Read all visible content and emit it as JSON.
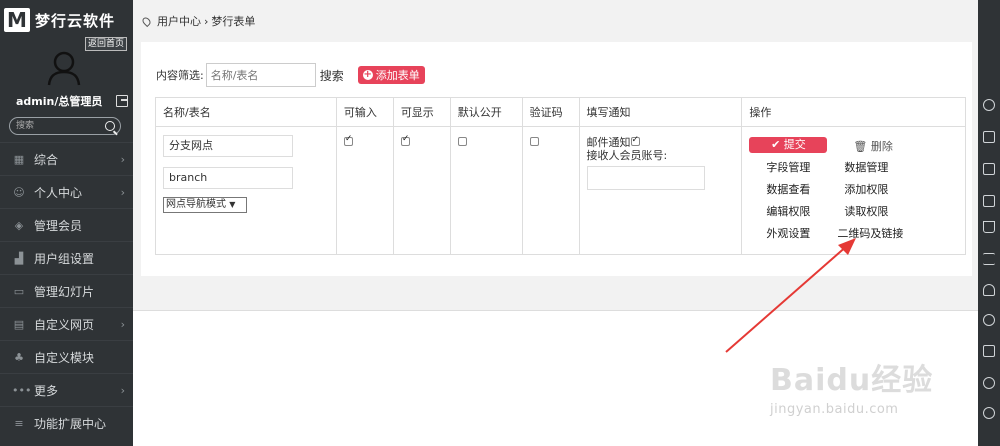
{
  "brand": {
    "logo_letter": "M",
    "name": "梦行云软件",
    "back_home": "返回首页"
  },
  "user": {
    "name": "admin/总管理员"
  },
  "sidebar": {
    "search_placeholder": "搜索",
    "items": [
      {
        "label": "综合",
        "icon": "grid-icon",
        "has_arrow": true
      },
      {
        "label": "个人中心",
        "icon": "user-icon",
        "has_arrow": true
      },
      {
        "label": "管理会员",
        "icon": "layers-icon",
        "has_arrow": false
      },
      {
        "label": "用户组设置",
        "icon": "bar-chart-icon",
        "has_arrow": false
      },
      {
        "label": "管理幻灯片",
        "icon": "slides-icon",
        "has_arrow": false
      },
      {
        "label": "自定义网页",
        "icon": "calendar-icon",
        "has_arrow": true
      },
      {
        "label": "自定义模块",
        "icon": "modules-icon",
        "has_arrow": false
      },
      {
        "label": "更多",
        "icon": "more-icon",
        "has_arrow": true
      },
      {
        "label": "功能扩展中心",
        "icon": "menu-icon",
        "has_arrow": false
      }
    ]
  },
  "breadcrumb": {
    "home": "用户中心",
    "separator": "›",
    "current": "梦行表单"
  },
  "filter": {
    "label": "内容筛选:",
    "placeholder": "名称/表名",
    "search": "搜索",
    "add_button": "添加表单"
  },
  "table": {
    "headers": [
      "名称/表名",
      "可输入",
      "可显示",
      "默认公开",
      "验证码",
      "填写通知",
      "操作"
    ],
    "row": {
      "name": "分支网点",
      "table_name": "branch",
      "mode": "网点导航模式",
      "writable": true,
      "displayable": true,
      "public_default": false,
      "captcha": false,
      "notify_label": "邮件通知",
      "notify_checked": true,
      "recipient_label": "接收人会员账号:",
      "recipient_value": "",
      "ops": {
        "submit": "提交",
        "delete": "删除",
        "field_manage": "字段管理",
        "data_manage": "数据管理",
        "data_view": "数据查看",
        "add_permission": "添加权限",
        "edit_permission": "编辑权限",
        "read_permission": "读取权限",
        "appearance": "外观设置",
        "qr_link": "二维码及链接"
      }
    }
  },
  "watermark": {
    "main": "Baidu经验",
    "url": "jingyan.baidu.com"
  },
  "colors": {
    "sidebar_bg": "#2f3336",
    "accent": "#e7435a",
    "arrow": "#e53935"
  },
  "right_toolbar": [
    "share-icon",
    "message-icon",
    "edit-icon",
    "qrcode-icon",
    "cart-icon",
    "list-icon",
    "person-icon",
    "star-icon",
    "print-icon",
    "help-icon",
    "share-link-icon"
  ]
}
